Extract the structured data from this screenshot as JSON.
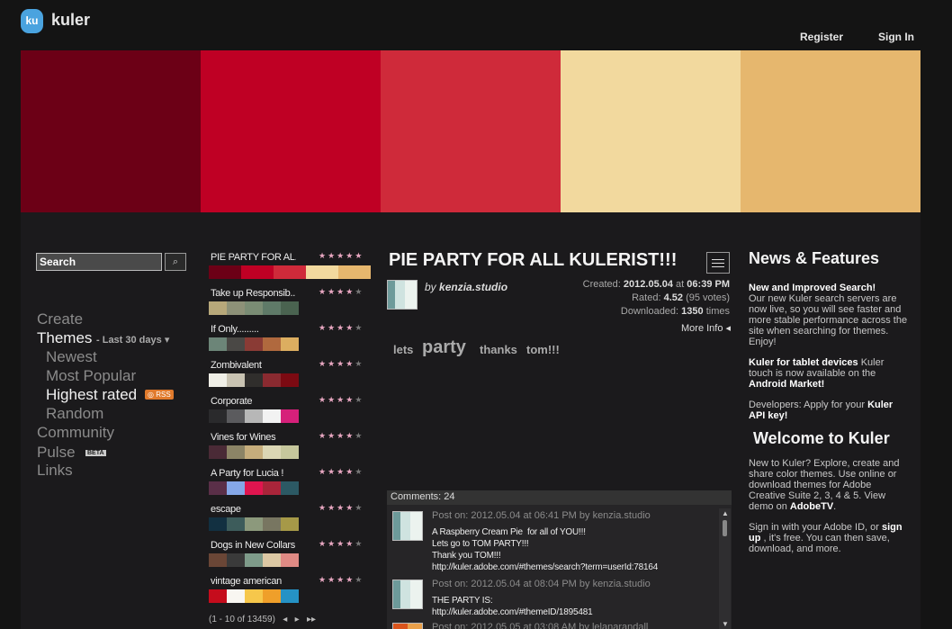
{
  "header": {
    "brand": "kuler",
    "logo_text": "ku",
    "register": "Register",
    "sign_in": "Sign In"
  },
  "hero_colors": [
    "#6c0016",
    "#bf0024",
    "#cf2a3a",
    "#f2d99e",
    "#e6b76e"
  ],
  "search": {
    "value": "Search"
  },
  "nav": {
    "create": "Create",
    "themes": "Themes",
    "themes_filter": "- Last 30 days",
    "newest": "Newest",
    "most_popular": "Most Popular",
    "highest_rated": "Highest rated",
    "rss": "RSS",
    "random": "Random",
    "community": "Community",
    "pulse": "Pulse",
    "beta": "BETA",
    "links": "Links"
  },
  "themes": [
    {
      "name": "PIE PARTY  FOR AL...",
      "stars": 5,
      "colors": [
        "#6c0016",
        "#bf0024",
        "#cf2a3a",
        "#f2d99e",
        "#e6b76e"
      ]
    },
    {
      "name": "Take up Responsib...",
      "stars": 4,
      "colors": [
        "#b7a87a",
        "#8d9178",
        "#7a8c74",
        "#5f7a68",
        "#4a6350"
      ]
    },
    {
      "name": "If Only.........",
      "stars": 4,
      "colors": [
        "#6c8578",
        "#4a4845",
        "#8a3b35",
        "#b0693e",
        "#dcae60"
      ]
    },
    {
      "name": "Zombivalent",
      "stars": 4,
      "colors": [
        "#efeee6",
        "#c9c3b2",
        "#302e2c",
        "#8a2a30",
        "#7c0a12"
      ]
    },
    {
      "name": "Corporate",
      "stars": 4,
      "colors": [
        "#2a2a2c",
        "#5b5b5e",
        "#b7b7b7",
        "#f2f2f2",
        "#d6207a"
      ]
    },
    {
      "name": "Vines for Wines",
      "stars": 4,
      "colors": [
        "#4a2a36",
        "#8c8466",
        "#c6ad7c",
        "#dbd6b4",
        "#c6c79c"
      ]
    },
    {
      "name": "A Party for Lucia !",
      "stars": 4,
      "colors": [
        "#5a2f48",
        "#85a7e8",
        "#e0154f",
        "#a9253a",
        "#2c5964"
      ]
    },
    {
      "name": "escape",
      "stars": 4,
      "colors": [
        "#123041",
        "#3d5c5b",
        "#8c997c",
        "#787661",
        "#a69948"
      ]
    },
    {
      "name": "Dogs in New Collars",
      "stars": 4,
      "colors": [
        "#6a4636",
        "#3a3a3a",
        "#7e9b8a",
        "#dcc8a4",
        "#df8a84"
      ]
    },
    {
      "name": "vintage american",
      "stars": 4,
      "colors": [
        "#c50c1c",
        "#f8f6f1",
        "#f6c74b",
        "#ef9f2a",
        "#2592c5"
      ]
    }
  ],
  "pager": {
    "text": "(1 - 10 of 13459)",
    "prev": "◂",
    "next": "▸",
    "last": "▸▸"
  },
  "detail": {
    "title": "PIE PARTY  FOR ALL KULERIST!!!",
    "by_prefix": "by",
    "author": "kenzia.studio",
    "created_label": "Created:",
    "created_date": "2012.05.04",
    "created_at": "at",
    "created_time": "06:39 PM",
    "rated_label": "Rated:",
    "rated_value": "4.52",
    "rated_votes": "(95 votes)",
    "downloaded_label": "Downloaded:",
    "downloaded_value": "1350",
    "downloaded_suffix": "times",
    "more_info": "More Info",
    "tags": [
      "lets",
      "party",
      "thanks",
      "tom!!!"
    ]
  },
  "comments": {
    "header": "Comments: 24",
    "items": [
      {
        "head": "Post on: 2012.05.04 at 06:41 PM by kenzia.studio",
        "body": "A Raspberry Cream Pie  for all of YOU!!!\nLets go to TOM PARTY!!!\nThank you TOM!!!\nhttp://kuler.adobe.com/#themes/search?term=userId:78164"
      },
      {
        "head": "Post on: 2012.05.04 at 08:04 PM by kenzia.studio",
        "body": "THE PARTY IS:\nhttp://kuler.adobe.com/#themeID/1895481"
      },
      {
        "head": "Post on: 2012.05.05 at 03:08 AM by lelanarandall",
        "body": ""
      }
    ]
  },
  "sidebar": {
    "news_title": "News & Features",
    "news1_title": "New and Improved Search!",
    "news1_body": "Our new Kuler search servers are now live, so you will see faster and more stable performance across the site when searching for themes.  Enjoy!",
    "news2_title": "Kuler for tablet devices",
    "news2_body": " Kuler touch is now available on the ",
    "news2_link": "Android Market!",
    "news3_prefix": "Developers: Apply for your ",
    "news3_link": "Kuler API key!",
    "welcome_title": "Welcome to Kuler",
    "welcome_body": "New to Kuler? Explore, create and share color themes. Use online or download themes for Adobe Creative Suite 2, 3, 4 & 5. View demo on ",
    "welcome_link": "AdobeTV",
    "welcome_end": ".",
    "signin_prefix": "Sign in with your Adobe ID, or ",
    "signin_link": "sign up",
    "signin_suffix": " , it's free. You can then save, download, and more."
  }
}
